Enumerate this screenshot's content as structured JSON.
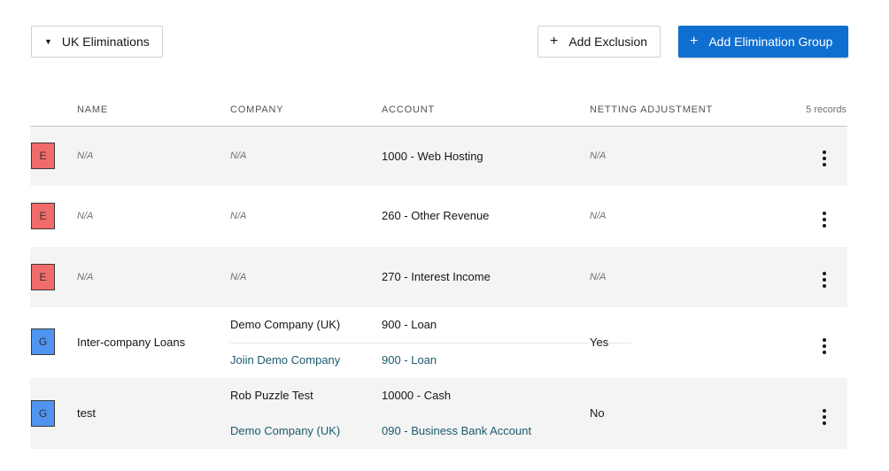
{
  "toolbar": {
    "group_select_label": "UK Eliminations",
    "add_exclusion_label": "Add Exclusion",
    "add_group_label": "Add Elimination Group",
    "primary_color": "#0f6fd0"
  },
  "table": {
    "headers": {
      "name": "NAME",
      "company": "COMPANY",
      "account": "ACCOUNT",
      "netting": "NETTING ADJUSTMENT",
      "records": "5 records"
    },
    "rows": [
      {
        "badge": "E",
        "name": "N/A",
        "company": "N/A",
        "account": "1000 - Web Hosting",
        "netting": "N/A"
      },
      {
        "badge": "E",
        "name": "N/A",
        "company": "N/A",
        "account": "260 - Other Revenue",
        "netting": "N/A"
      },
      {
        "badge": "E",
        "name": "N/A",
        "company": "N/A",
        "account": "270 - Interest Income",
        "netting": "N/A"
      },
      {
        "badge": "G",
        "name": "Inter-company Loans",
        "company_1": "Demo Company (UK)",
        "account_1": "900 - Loan",
        "company_2": "Joiin Demo Company",
        "account_2": "900 - Loan",
        "netting": "Yes"
      },
      {
        "badge": "G",
        "name": "test",
        "company_1": "Rob Puzzle Test",
        "account_1": "10000 - Cash",
        "company_2": "Demo Company (UK)",
        "account_2": "090 - Business Bank Account",
        "netting": "No"
      }
    ],
    "badge_colors": {
      "E": "#f26b6b",
      "G": "#4f94f0"
    }
  }
}
